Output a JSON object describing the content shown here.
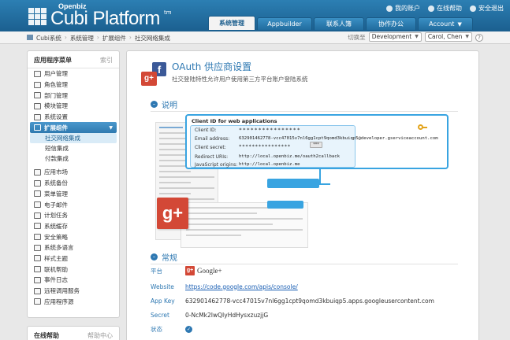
{
  "header": {
    "brand_small": "Openbiz",
    "brand": "Cubi Platform",
    "tm": "tm",
    "user_links": [
      {
        "label": "我的账户"
      },
      {
        "label": "在线帮助"
      },
      {
        "label": "安全退出"
      }
    ],
    "tabs": [
      {
        "label": "系统管理",
        "active": true
      },
      {
        "label": "Appbuilder"
      },
      {
        "label": "联系人簿"
      },
      {
        "label": "协作办公"
      },
      {
        "label": "Account"
      }
    ]
  },
  "breadcrumb": {
    "items": [
      "Cubi系统",
      "系统管理",
      "扩展组件",
      "社交网络集成"
    ],
    "env_label": "切换至",
    "env_value": "Development",
    "user_value": "Carol, Chen"
  },
  "sidebar": {
    "title": "应用程序菜单",
    "index_label": "索引",
    "items_before": [
      "用户管理",
      "角色管理",
      "部门管理",
      "模块管理",
      "系统设置"
    ],
    "group": "扩展组件",
    "sub_items": [
      "社交网络集成",
      "短信集成",
      "付款集成"
    ],
    "active_sub": "社交网络集成",
    "items_after": [
      "应用市场",
      "系统备份",
      "菜单管理",
      "电子邮件",
      "计划任务",
      "系统缓存",
      "安全策略",
      "系统多语言",
      "样式主题",
      "联机帮助",
      "事件日志",
      "远程调用服务",
      "应用程序源"
    ]
  },
  "help_panel": {
    "title": "在线帮助",
    "link": "帮助中心"
  },
  "main": {
    "title": "OAuth 供应商设置",
    "subtitle": "社交登陆特性允许用户使用第三方平台账户登陆系统",
    "section_desc": "说明",
    "section_general": "常规",
    "illustration": {
      "card_title": "Client ID for web applications",
      "fields": [
        {
          "label": "Client ID:",
          "value": "****************"
        },
        {
          "label": "Email address:",
          "value": "632901462778-vcc47015v7nl6gg1cpt9qomd3kbuiqp5@developer.gserviceaccount.com"
        },
        {
          "label": "Client secret:",
          "value": "****************"
        },
        {
          "label": "Redirect URIs:",
          "value": "http://local.openbiz.me/oauth2callback"
        },
        {
          "label": "JavaScript origins:",
          "value": "http://local.openbiz.me"
        }
      ],
      "reset_label": "***"
    },
    "details": [
      {
        "key": "平台",
        "value": "Google+",
        "type": "logo"
      },
      {
        "key": "Website",
        "value": "https://code.google.com/apis/console/",
        "type": "link"
      },
      {
        "key": "App Key",
        "value": "632901462778-vcc47015v7nl6gg1cpt9qomd3kbuiqp5.apps.googleusercontent.com",
        "type": "text"
      },
      {
        "key": "Secret",
        "value": "0-NcMk2IwQIyHdHysxzuzjjG",
        "type": "text"
      },
      {
        "key": "状态",
        "value": "",
        "type": "check"
      }
    ]
  },
  "colors": {
    "header": "#1b5f8f",
    "accent": "#2e78b2",
    "highlight": "#39a4e1",
    "google_red": "#d34836",
    "facebook_blue": "#3b5998"
  },
  "icons": [
    "user-icon",
    "help-icon",
    "logout-icon",
    "home-icon",
    "facebook-icon",
    "google-plus-icon",
    "key-icon",
    "check-icon"
  ]
}
